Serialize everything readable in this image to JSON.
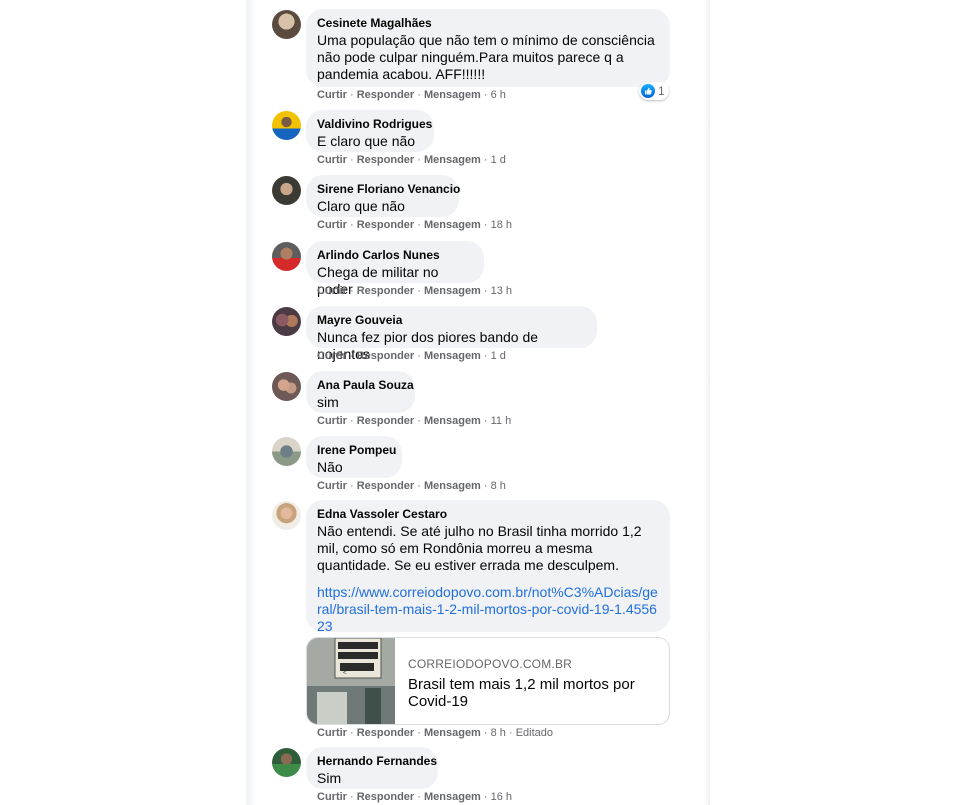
{
  "actions": {
    "like": "Curtir",
    "reply": "Responder",
    "message": "Mensagem"
  },
  "comments": [
    {
      "author": "Cesinete Magalhães",
      "text": "Uma população que não tem o mínimo de consciência não pode culpar ninguém.Para muitos parece q a pandemia acabou. AFF!!!!!!",
      "time": "6 h",
      "reactions": {
        "icon": "like-icon",
        "count": "1"
      }
    },
    {
      "author": "Valdivino Rodrigues",
      "text": "E claro que não",
      "time": "1 d"
    },
    {
      "author": "Sirene Floriano Venancio",
      "text": "Claro que não",
      "time": "18 h"
    },
    {
      "author": "Arlindo Carlos Nunes",
      "text": "Chega de militar no poder",
      "time": "13 h"
    },
    {
      "author": "Mayre Gouveia",
      "text": "Nunca fez pior dos piores bando de nojentos",
      "time": "1 d"
    },
    {
      "author": "Ana Paula Souza",
      "text": "sim",
      "time": "11 h"
    },
    {
      "author": "Irene Pompeu",
      "text": "Não",
      "time": "8 h"
    },
    {
      "author": "Edna Vassoler Cestaro",
      "text": "Não entendi. Se até julho no Brasil tinha morrido 1,2 mil, como só em Rondônia morreu a mesma quantidade. Se eu estiver errada me desculpem.",
      "link": "https://www.correiodopovo.com.br/not%C3%ADcias/geral/brasil-tem-mais-1-2-mil-mortos-por-covid-19-1.455623",
      "time": "8 h",
      "edited": "Editado",
      "preview": {
        "domain": "CORREIODOPOVO.COM.BR",
        "title": "Brasil tem mais 1,2 mil mortos por Covid-19",
        "image_text": "ÁREA DE ISOLAMENTO COVID-19"
      }
    },
    {
      "author": "Hernando Fernandes",
      "text": "Sim",
      "time": "16 h"
    }
  ]
}
